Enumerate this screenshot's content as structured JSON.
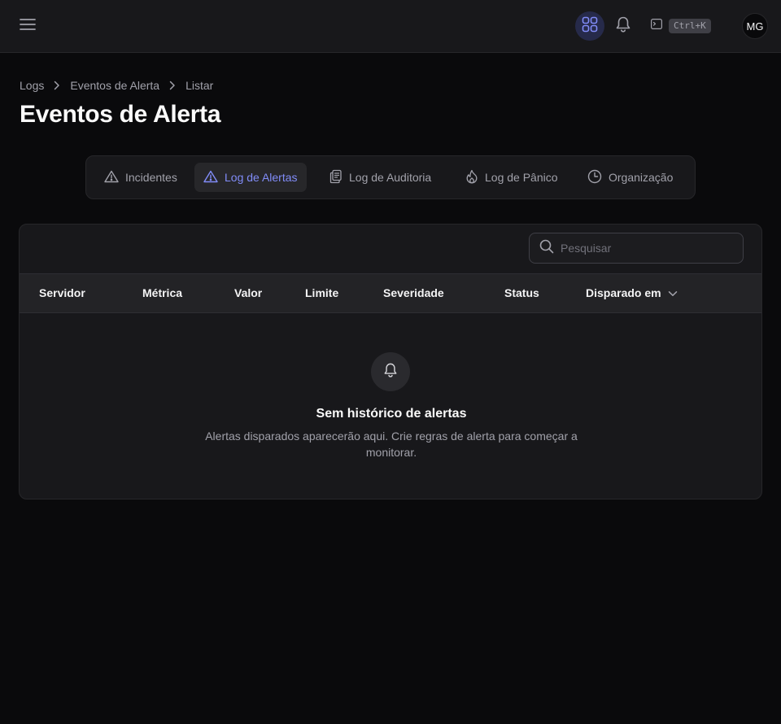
{
  "topbar": {
    "shortcut": "Ctrl+K",
    "avatar_initials": "MG",
    "icons": [
      "hamburger-icon",
      "apps-grid-icon",
      "bell-icon",
      "terminal-icon"
    ],
    "accent": "#818cf8"
  },
  "breadcrumb": [
    "Logs",
    "Eventos de Alerta",
    "Listar"
  ],
  "page_title": "Eventos de Alerta",
  "tabs": [
    {
      "label": "Incidentes",
      "icon": "warning-icon",
      "active": false
    },
    {
      "label": "Log de Alertas",
      "icon": "warning-icon",
      "active": true
    },
    {
      "label": "Log de Auditoria",
      "icon": "clipboard-icon",
      "active": false
    },
    {
      "label": "Log de Pânico",
      "icon": "fire-icon",
      "active": false
    },
    {
      "label": "Organização",
      "icon": "clock-icon",
      "active": false
    }
  ],
  "search": {
    "placeholder": "Pesquisar"
  },
  "table": {
    "columns": [
      "Servidor",
      "Métrica",
      "Valor",
      "Limite",
      "Severidade",
      "Status",
      "Disparado em"
    ],
    "sorted_column": "Disparado em",
    "rows": []
  },
  "empty_state": {
    "title": "Sem histórico de alertas",
    "description": "Alertas disparados aparecerão aqui. Crie regras de alerta para começar a monitorar."
  },
  "colors": {
    "background": "#0a0a0c",
    "surface": "#18181b",
    "active_tab_text": "#818cf8"
  }
}
